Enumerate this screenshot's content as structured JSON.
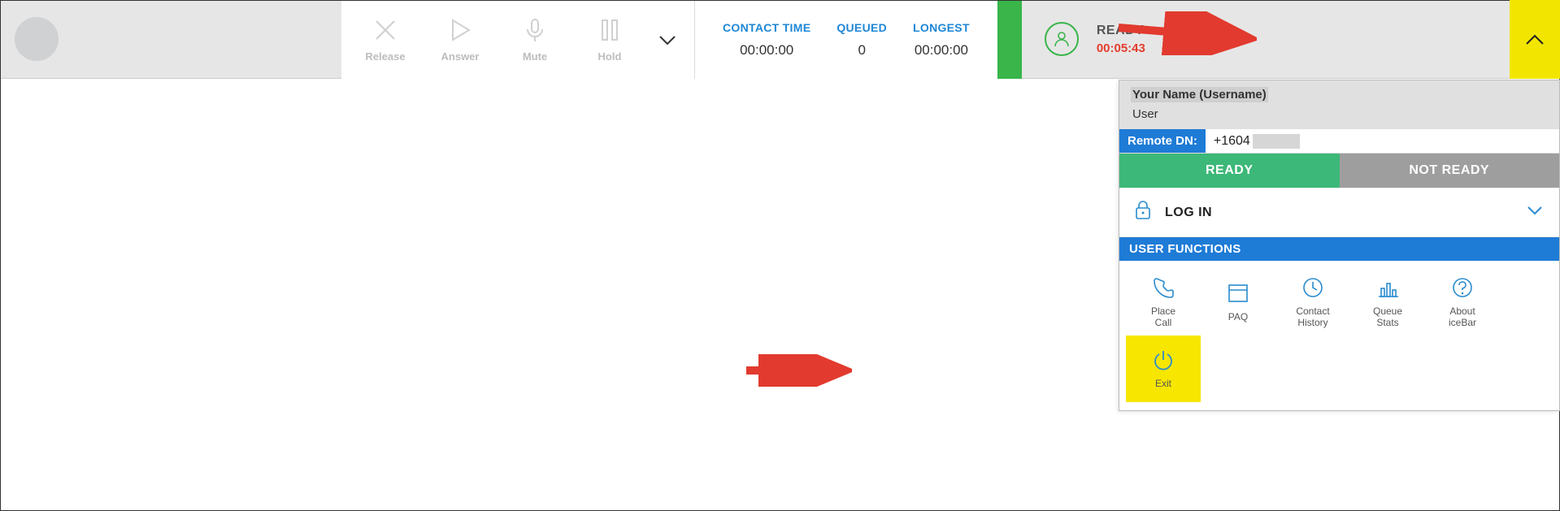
{
  "toolbar": {
    "release": "Release",
    "answer": "Answer",
    "mute": "Mute",
    "hold": "Hold"
  },
  "stats": {
    "contact_time": {
      "label": "CONTACT TIME",
      "value": "00:00:00"
    },
    "queued": {
      "label": "QUEUED",
      "value": "0"
    },
    "longest": {
      "label": "LONGEST",
      "value": "00:00:00"
    }
  },
  "status": {
    "label": "READY",
    "timer": "00:05:43"
  },
  "panel": {
    "username_display": "Your Name (Username)",
    "role": "User",
    "remote_dn_label": "Remote DN:",
    "remote_dn_value": "+1604",
    "ready_btn": "READY",
    "notready_btn": "NOT READY",
    "login_label": "LOG IN",
    "funcs_header": "USER FUNCTIONS",
    "funcs": {
      "place_call": "Place\nCall",
      "paq": "PAQ",
      "contact_history": "Contact\nHistory",
      "queue_stats": "Queue\nStats",
      "about": "About\niceBar",
      "exit": "Exit"
    }
  }
}
